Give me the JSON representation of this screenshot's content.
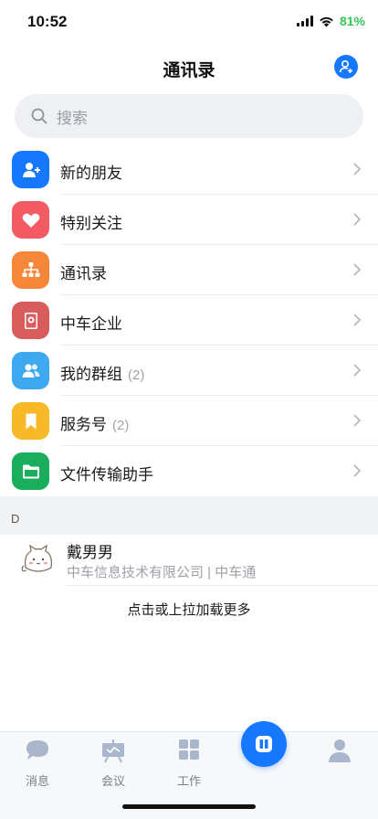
{
  "status_bar": {
    "time": "10:52",
    "battery": "81%"
  },
  "header": {
    "title": "通讯录"
  },
  "search": {
    "placeholder": "搜索"
  },
  "menu": [
    {
      "label": "新的朋友",
      "count": "",
      "icon": "add-friend-icon",
      "color": "#1677ff"
    },
    {
      "label": "特别关注",
      "count": "",
      "icon": "heart-icon",
      "color": "#f25a64"
    },
    {
      "label": "通讯录",
      "count": "",
      "icon": "org-chart-icon",
      "color": "#f5873a"
    },
    {
      "label": "中车企业",
      "count": "",
      "icon": "enterprise-book-icon",
      "color": "#d95c5c"
    },
    {
      "label": "我的群组",
      "count": "(2)",
      "icon": "group-icon",
      "color": "#3ea8f0"
    },
    {
      "label": "服务号",
      "count": "(2)",
      "icon": "bookmark-icon",
      "color": "#f7b928"
    },
    {
      "label": "文件传输助手",
      "count": "",
      "icon": "folder-icon",
      "color": "#1aad5b"
    }
  ],
  "section": {
    "letter": "D"
  },
  "contact": {
    "name": "戴男男",
    "org": "中车信息技术有限公司 | 中车通"
  },
  "load_more": "点击或上拉加载更多",
  "tabs": [
    {
      "label": "消息",
      "icon": "chat-icon"
    },
    {
      "label": "会议",
      "icon": "meeting-icon"
    },
    {
      "label": "工作",
      "icon": "grid-icon"
    },
    {
      "label": "",
      "icon": "center-app-icon"
    },
    {
      "label": "",
      "icon": "profile-icon"
    }
  ]
}
